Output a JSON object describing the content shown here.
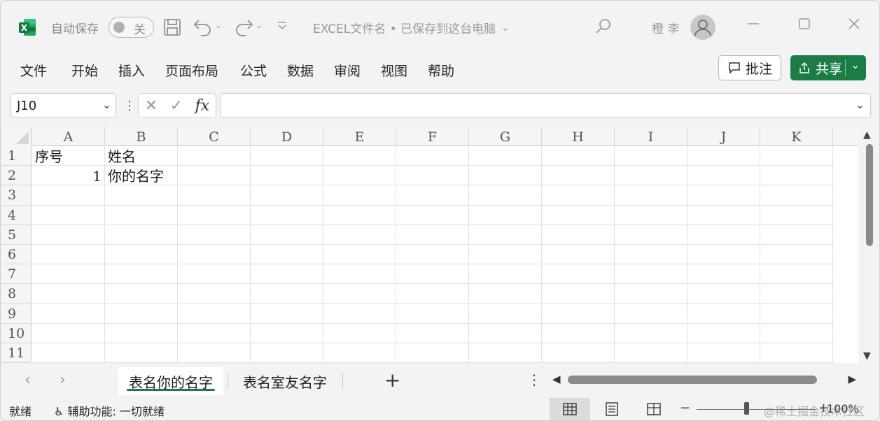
{
  "app": {
    "logo_letter": "X",
    "brand_color": "#1b7c45"
  },
  "titlebar": {
    "autosave_label": "自动保存",
    "autosave_state": "关",
    "document_title": "EXCEL文件名 • 已保存到这台电脑",
    "user_name": "橙 李"
  },
  "menu": {
    "items": [
      "文件",
      "开始",
      "插入",
      "页面布局",
      "公式",
      "数据",
      "审阅",
      "视图",
      "帮助"
    ],
    "comment_label": "批注",
    "share_label": "共享"
  },
  "formula_bar": {
    "name_box": "J10",
    "fx_label": "fx",
    "formula": ""
  },
  "sheet": {
    "columns": [
      "A",
      "B",
      "C",
      "D",
      "E",
      "F",
      "G",
      "H",
      "I",
      "J",
      "K"
    ],
    "rows": [
      "1",
      "2",
      "3",
      "4",
      "5",
      "6",
      "7",
      "8",
      "9",
      "10",
      "11"
    ],
    "cells": {
      "A1": "序号",
      "B1": "姓名",
      "A2": "1",
      "B2": "你的名字"
    }
  },
  "tabs": {
    "sheets": [
      "表名你的名字",
      "表名室友名字"
    ],
    "active_index": 0,
    "add_label": "+"
  },
  "statusbar": {
    "ready": "就绪",
    "accessibility": "辅助功能: 一切就绪",
    "zoom": "100%",
    "watermark": "@稀土掘金技术社区"
  }
}
